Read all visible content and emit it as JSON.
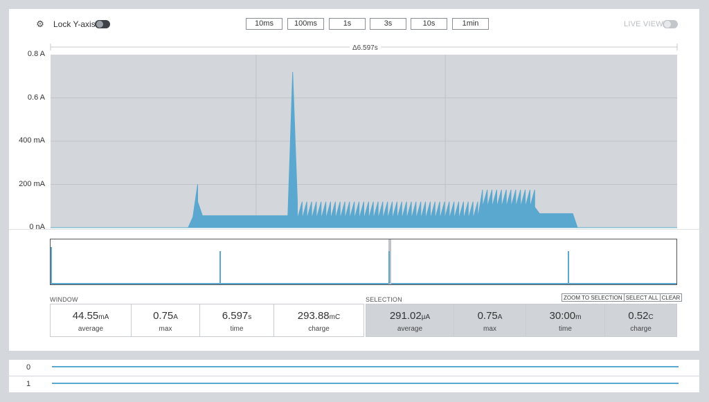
{
  "toolbar": {
    "gear_icon": "gear-icon",
    "lock_label": "Lock Y-axis",
    "lock_state": false,
    "window_buttons": [
      "10ms",
      "100ms",
      "1s",
      "3s",
      "10s",
      "1min"
    ],
    "live_label": "LIVE VIEW",
    "live_state": false
  },
  "chart": {
    "delta_label": "Δ6.597s",
    "y_ticks": [
      "0.8 A",
      "0.6 A",
      "400 mA",
      "200 mA",
      "0 nA"
    ],
    "colors": {
      "trace": "#5aa8cf",
      "plot_bg": "#d3d7db",
      "grid": "#bfc4c9"
    }
  },
  "chart_data": {
    "type": "line",
    "series": [
      {
        "values_mA": [
          0,
          0,
          0,
          0,
          0,
          0,
          0,
          0,
          0,
          0,
          0,
          0,
          0,
          0,
          0,
          0,
          0,
          0,
          0,
          0,
          0,
          0,
          0,
          0,
          0,
          0,
          0,
          0,
          0,
          0,
          50,
          190,
          55,
          55,
          55,
          55,
          55,
          55,
          55,
          55,
          55,
          55,
          55,
          55,
          55,
          55,
          55,
          55,
          55,
          55,
          55,
          720,
          110,
          110,
          110,
          110,
          110,
          110,
          110,
          110,
          110,
          110,
          110,
          110,
          110,
          110,
          110,
          110,
          110,
          110,
          110,
          110,
          110,
          110,
          110,
          110,
          110,
          110,
          110,
          110,
          110,
          110,
          110,
          110,
          110,
          110,
          110,
          110,
          110,
          110,
          110,
          165,
          165,
          165,
          165,
          165,
          165,
          165,
          165,
          165,
          165,
          165,
          165,
          65,
          65,
          65,
          65,
          65,
          65,
          65,
          65,
          0,
          0,
          0,
          0,
          0,
          0,
          0,
          0,
          0,
          0,
          0,
          0,
          0,
          0,
          0,
          0,
          0,
          0,
          0,
          0,
          0,
          0
        ]
      }
    ],
    "ylim_mA": [
      0,
      800
    ],
    "grid": true
  },
  "window_stats": {
    "title": "WINDOW",
    "cells": [
      {
        "value": "44.55",
        "unit": "mA",
        "label": "average"
      },
      {
        "value": "0.75",
        "unit": "A",
        "label": "max"
      },
      {
        "value": "6.597",
        "unit": "s",
        "label": "time"
      },
      {
        "value": "293.88",
        "unit": "mC",
        "label": "charge"
      }
    ]
  },
  "selection_stats": {
    "title": "SELECTION",
    "buttons": [
      "ZOOM TO SELECTION",
      "SELECT ALL",
      "CLEAR"
    ],
    "cells": [
      {
        "value": "291.02",
        "unit": "μA",
        "label": "average"
      },
      {
        "value": "0.75",
        "unit": "A",
        "label": "max"
      },
      {
        "value": "30:00",
        "unit": "m",
        "label": "time"
      },
      {
        "value": "0.52",
        "unit": "C",
        "label": "charge"
      }
    ]
  },
  "digital_channels": [
    "0",
    "1"
  ]
}
